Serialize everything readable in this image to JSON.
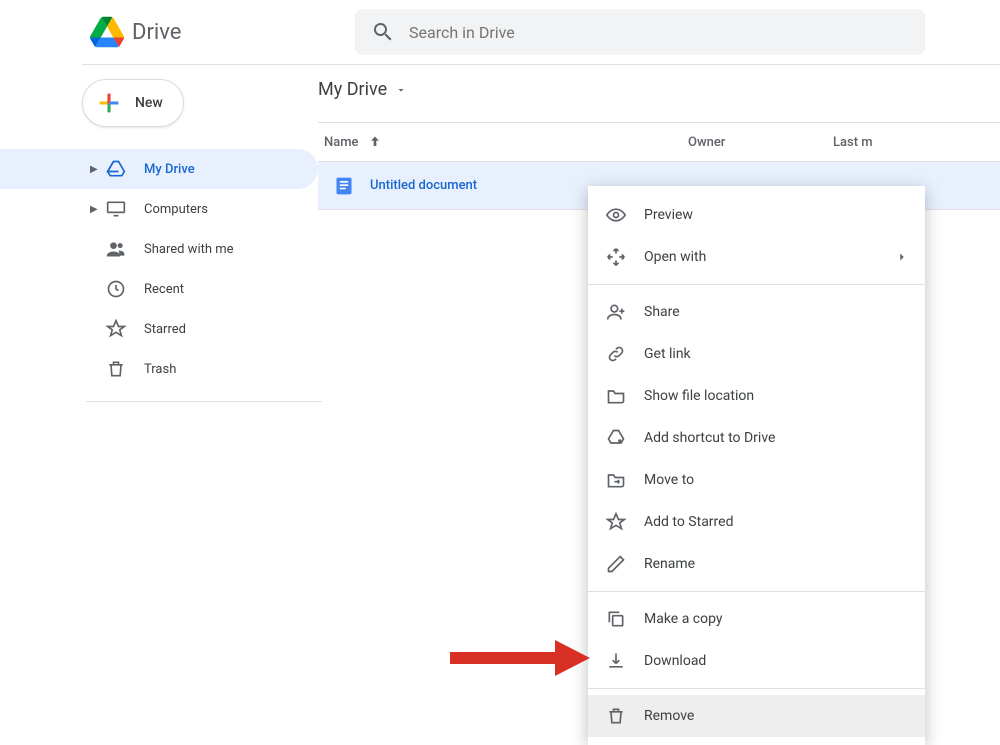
{
  "app": {
    "name": "Drive"
  },
  "search": {
    "placeholder": "Search in Drive"
  },
  "sidebar": {
    "new_label": "New",
    "items": [
      {
        "label": "My Drive",
        "icon": "drive-icon",
        "expandable": true,
        "active": true
      },
      {
        "label": "Computers",
        "icon": "computer-icon",
        "expandable": true,
        "active": false
      },
      {
        "label": "Shared with me",
        "icon": "people-icon",
        "expandable": false,
        "active": false
      },
      {
        "label": "Recent",
        "icon": "clock-icon",
        "expandable": false,
        "active": false
      },
      {
        "label": "Starred",
        "icon": "star-icon",
        "expandable": false,
        "active": false
      },
      {
        "label": "Trash",
        "icon": "trash-icon",
        "expandable": false,
        "active": false
      }
    ]
  },
  "breadcrumb": {
    "label": "My Drive"
  },
  "table": {
    "columns": {
      "name": "Name",
      "owner": "Owner",
      "last": "Last m"
    },
    "rows": [
      {
        "name": "Untitled document",
        "type": "docs",
        "selected": true
      }
    ]
  },
  "context_menu": {
    "groups": [
      [
        {
          "label": "Preview",
          "icon": "eye-icon",
          "submenu": false
        },
        {
          "label": "Open with",
          "icon": "openwith-icon",
          "submenu": true
        }
      ],
      [
        {
          "label": "Share",
          "icon": "person-add-icon"
        },
        {
          "label": "Get link",
          "icon": "link-icon"
        },
        {
          "label": "Show file location",
          "icon": "folder-icon"
        },
        {
          "label": "Add shortcut to Drive",
          "icon": "shortcut-icon"
        },
        {
          "label": "Move to",
          "icon": "move-icon"
        },
        {
          "label": "Add to Starred",
          "icon": "star-icon"
        },
        {
          "label": "Rename",
          "icon": "pencil-icon"
        }
      ],
      [
        {
          "label": "Make a copy",
          "icon": "copy-icon"
        },
        {
          "label": "Download",
          "icon": "download-icon"
        }
      ],
      [
        {
          "label": "Remove",
          "icon": "trash-icon",
          "highlighted": true
        }
      ]
    ]
  }
}
